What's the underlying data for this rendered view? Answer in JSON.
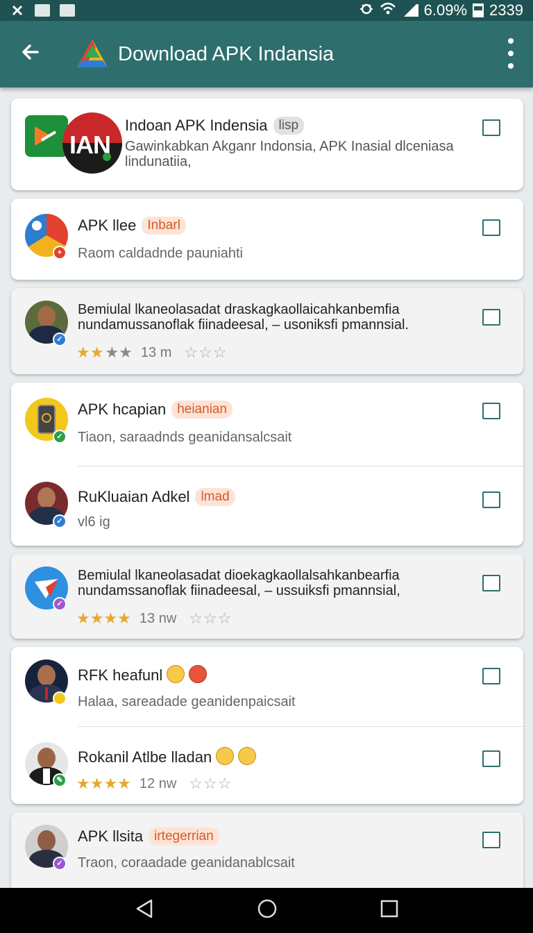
{
  "status_bar": {
    "battery_text": "6.09%",
    "time": "2339"
  },
  "app_bar": {
    "title": "Download APK Indansia"
  },
  "items": [
    {
      "title": "Indoan APK Indensia",
      "tag": "lisp",
      "line1": "Gawinkabkan Akganr Indonsia, APK Inasial dlceniasa",
      "line2": "linduna​tiia,",
      "logo_text": "IAN"
    },
    {
      "title": "APK llee",
      "tag": "Inbarl",
      "subtitle": "Raom  caldadnde pauniahti"
    },
    {
      "line1": "Bemiulal lkaneolasadat draskagkaollaicahkanbemfia",
      "line2": "nundamussanoflak fiinadeesal, – usoniksfi pmannsial.",
      "rating_count": "13 m"
    },
    {
      "title": "APK hcapian",
      "tag": "heianian",
      "subtitle": "Tiaon, saraadnds geanidansalcsait"
    },
    {
      "title": "RuKluaian Adkel",
      "tag": "lmad",
      "subtitle": "vl6 ig"
    },
    {
      "line1": "Bemiulal lkaneolasadat dioekagkaollalsahkanbearfia",
      "line2": "nundamssanoflak fiinadeesal, – ussuiksfi pmannsial,",
      "rating_count": "13 nw"
    },
    {
      "title": "RFK heafunl",
      "subtitle": "Halaa, sareadade geanidenpaicsait"
    },
    {
      "title": "Rokanil Atlbe lladan",
      "rating_count": "12 nw"
    },
    {
      "title": "APK llsita",
      "tag": "irtegerrian",
      "subtitle": "Traon, coraadade geanidanablcsait"
    }
  ],
  "nav_bar": {
    "back": "back",
    "home": "home",
    "recents": "recents"
  }
}
